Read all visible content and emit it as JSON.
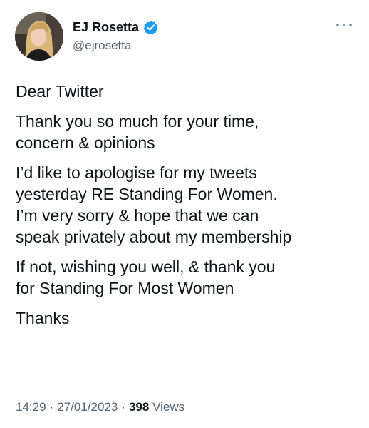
{
  "author": {
    "name": "EJ Rosetta",
    "handle": "@ejrosetta",
    "verified": true,
    "verified_color": "#1d9bf0"
  },
  "tweet": {
    "paragraphs": [
      "Dear Twitter",
      "Thank you so much for your time,\nconcern & opinions",
      "I’d like to apologise for my tweets\nyesterday RE Standing For Women.\nI’m very sorry & hope that we can\nspeak privately about my membership",
      "If not, wishing you well, & thank you\nfor Standing For Most Women",
      "Thanks"
    ]
  },
  "meta": {
    "time": "14:29",
    "separator": "·",
    "date": "27/01/2023",
    "views_count": "398",
    "views_label": "Views"
  },
  "icons": {
    "verified": "verified-badge-icon",
    "more": "more-options-icon"
  }
}
